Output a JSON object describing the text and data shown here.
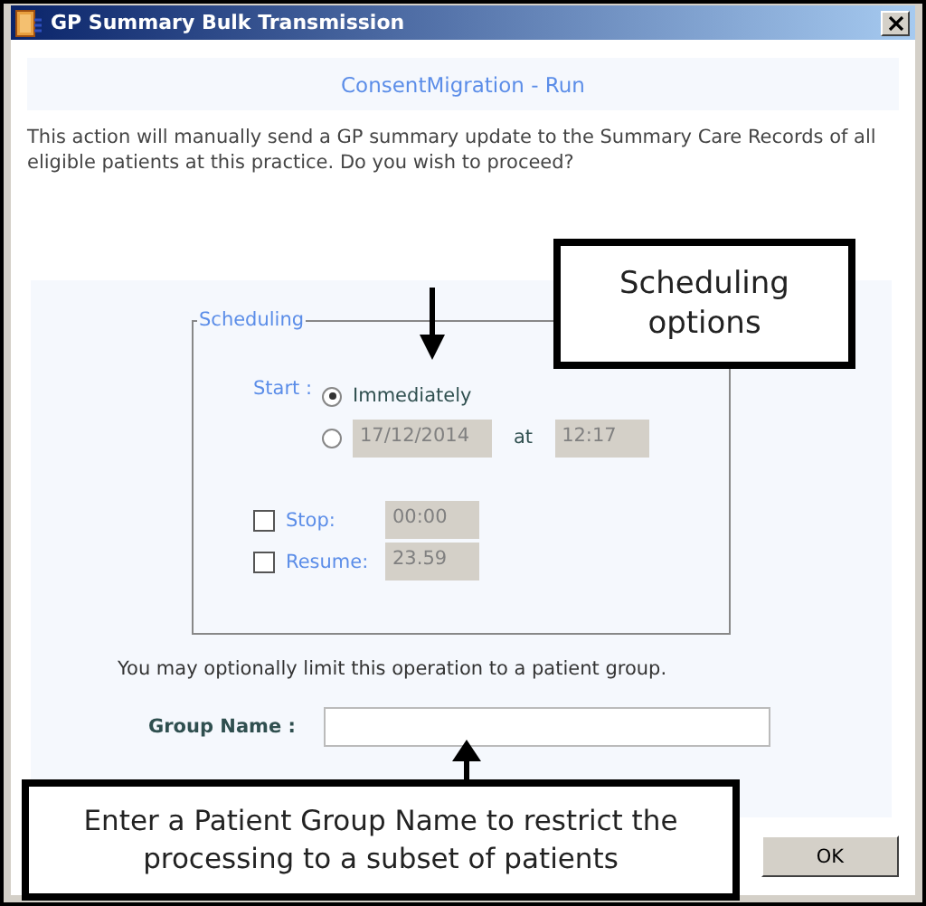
{
  "window": {
    "title": "GP Summary Bulk Transmission"
  },
  "header": "ConsentMigration - Run",
  "message": "This action will manually send a GP summary update to the Summary Care Records of all eligible patients at this practice. Do you wish to proceed?",
  "scheduling": {
    "legend": "Scheduling",
    "start_label": "Start :",
    "options": [
      {
        "kind": "immediate",
        "label": "Immediately",
        "selected": true
      },
      {
        "kind": "datetime",
        "date": "17/12/2014",
        "at": "at",
        "time": "12:17",
        "selected": false
      }
    ],
    "limits": [
      {
        "label": "Stop:",
        "checked": false,
        "value": "00:00"
      },
      {
        "label": "Resume:",
        "checked": false,
        "value": "23.59"
      }
    ]
  },
  "group_hint": "You may optionally limit this operation to a patient group.",
  "group_name": {
    "label": "Group Name :"
  },
  "buttons": [
    "OK"
  ],
  "callouts": [
    {
      "kind": "scheduling",
      "text": "Scheduling options"
    },
    {
      "kind": "group",
      "text": "Enter a Patient Group Name to restrict the processing to a subset of patients"
    }
  ]
}
